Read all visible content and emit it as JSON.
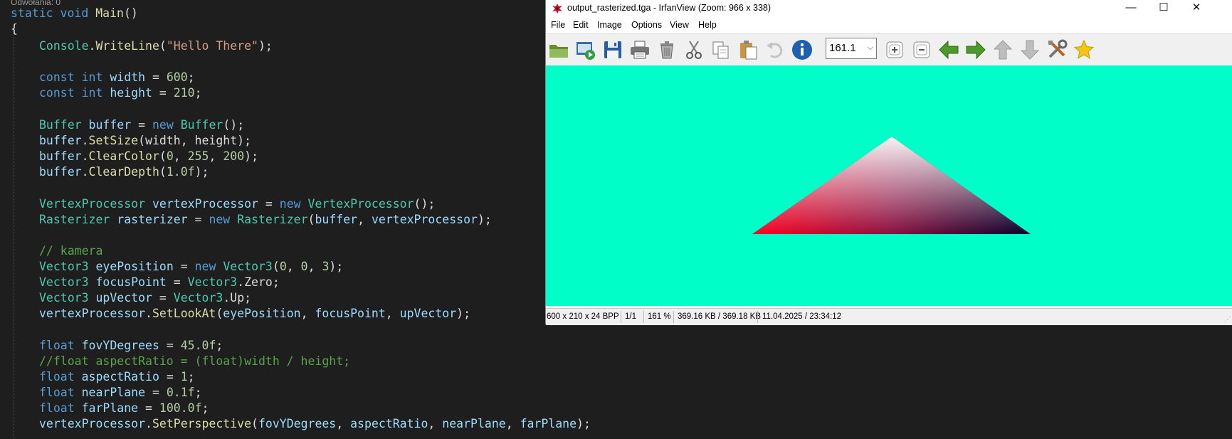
{
  "editor": {
    "references_label": "Odwołania: 0",
    "signature": {
      "kw1": "static",
      "kw2": "void",
      "name": "Main",
      "rest": "()"
    },
    "open_brace": "{",
    "lines": {
      "writeline": {
        "cls": "Console",
        "dot": ".",
        "fn": "WriteLine",
        "p1": "(",
        "str": "\"Hello There\"",
        "p2": ");"
      },
      "width": {
        "kw1": "const",
        "kw2": "int",
        "name": "width",
        "eq": " = ",
        "num": "600",
        "end": ";"
      },
      "height": {
        "kw1": "const",
        "kw2": "int",
        "name": "height",
        "eq": " = ",
        "num": "210",
        "end": ";"
      },
      "buffer_new": {
        "ty": "Buffer",
        "var": "buffer",
        "eq": " = ",
        "kw": "new",
        "ty2": "Buffer",
        "end": "();"
      },
      "set_size": {
        "var": "buffer",
        "dot": ".",
        "fn": "SetSize",
        "args": "(width, height);"
      },
      "clear_color": {
        "var": "buffer",
        "dot": ".",
        "fn": "ClearColor",
        "p1": "(",
        "n1": "0",
        "c1": ", ",
        "n2": "255",
        "c2": ", ",
        "n3": "200",
        "end": ");"
      },
      "clear_depth": {
        "var": "buffer",
        "dot": ".",
        "fn": "ClearDepth",
        "p1": "(",
        "n1": "1.0f",
        "end": ");"
      },
      "vp_new": {
        "ty": "VertexProcessor",
        "var": "vertexProcessor",
        "eq": " = ",
        "kw": "new",
        "ty2": "VertexProcessor",
        "end": "();"
      },
      "rast_new": {
        "ty": "Rasterizer",
        "var": "rasterizer",
        "eq": " = ",
        "kw": "new",
        "ty2": "Rasterizer",
        "p1": "(",
        "a1": "buffer",
        "c1": ", ",
        "a2": "vertexProcessor",
        "end": ");"
      },
      "comment_camera": "// kamera",
      "eye": {
        "ty": "Vector3",
        "var": "eyePosition",
        "eq": " = ",
        "kw": "new",
        "ty2": "Vector3",
        "p1": "(",
        "n1": "0",
        "c1": ", ",
        "n2": "0",
        "c2": ", ",
        "n3": "3",
        "end": ");"
      },
      "focus": {
        "ty": "Vector3",
        "var": "focusPoint",
        "eq": " = ",
        "ty2": "Vector3",
        "rest": ".Zero;"
      },
      "up": {
        "ty": "Vector3",
        "var": "upVector",
        "eq": " = ",
        "ty2": "Vector3",
        "rest": ".Up;"
      },
      "lookat": {
        "var": "vertexProcessor",
        "dot": ".",
        "fn": "SetLookAt",
        "p1": "(",
        "a1": "eyePosition",
        "c1": ", ",
        "a2": "focusPoint",
        "c2": ", ",
        "a3": "upVector",
        "end": ");"
      },
      "fov": {
        "kw": "float",
        "var": "fovYDegrees",
        "eq": " = ",
        "num": "45.0f",
        "end": ";"
      },
      "comment_aspect": "//float aspectRatio = (float)width / height;",
      "aspect": {
        "kw": "float",
        "var": "aspectRatio",
        "eq": " = ",
        "num": "1",
        "end": ";"
      },
      "near": {
        "kw": "float",
        "var": "nearPlane",
        "eq": " = ",
        "num": "0.1f",
        "end": ";"
      },
      "far": {
        "kw": "float",
        "var": "farPlane",
        "eq": " = ",
        "num": "100.0f",
        "end": ";"
      },
      "persp": {
        "var": "vertexProcessor",
        "dot": ".",
        "fn": "SetPerspective",
        "p1": "(",
        "a1": "fovYDegrees",
        "c1": ", ",
        "a2": "aspectRatio",
        "c2": ", ",
        "a3": "nearPlane",
        "c3": ", ",
        "a4": "farPlane",
        "end": ");"
      }
    }
  },
  "viewer": {
    "title": "output_rasterized.tga - IrfanView (Zoom: 966 x 338)",
    "window_buttons": {
      "minimize": "—",
      "maximize": "☐",
      "close": "✕"
    },
    "menu": [
      "File",
      "Edit",
      "Image",
      "Options",
      "View",
      "Help"
    ],
    "toolbar_icons": [
      "open-folder-icon",
      "slideshow-icon",
      "save-icon",
      "print-icon",
      "delete-icon",
      "cut-icon",
      "copy-icon",
      "paste-icon",
      "undo-icon",
      "info-icon",
      "zoom-in-icon",
      "zoom-out-icon",
      "previous-icon",
      "next-icon",
      "first-icon",
      "last-icon",
      "properties-icon",
      "favorite-icon"
    ],
    "zoom_value": "161.1",
    "canvas_color": "#00ffc8",
    "triangle_colors": {
      "top": "#ffffff",
      "left": "#ff0000",
      "right": "#000000"
    },
    "status": {
      "dimensions": "600 x 210 x 24 BPP",
      "page": "1/1",
      "zoom": "161 %",
      "size": "369.16 KB / 369.18 KB",
      "datetime": "11.04.2025 / 23:34:12"
    }
  }
}
